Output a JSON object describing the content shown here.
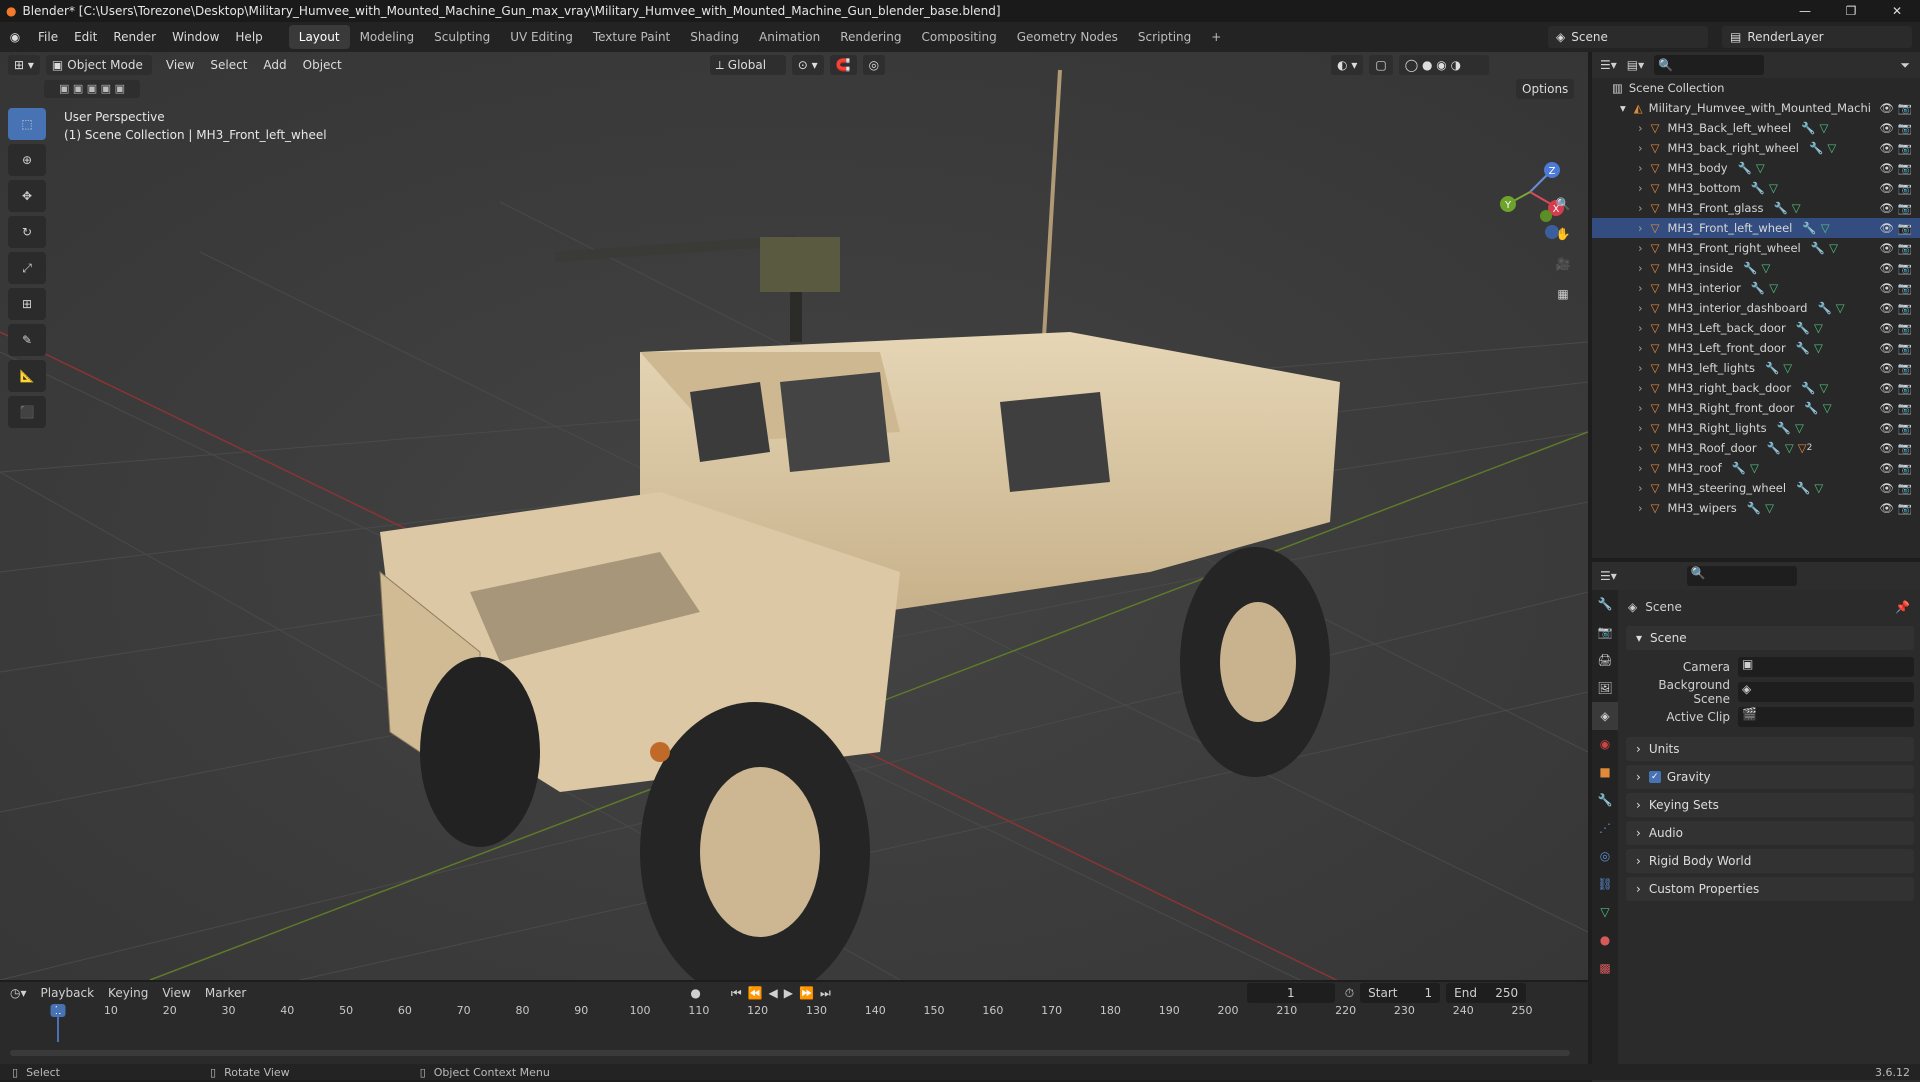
{
  "window": {
    "title": "Blender* [C:\\Users\\Torezone\\Desktop\\Military_Humvee_with_Mounted_Machine_Gun_max_vray\\Military_Humvee_with_Mounted_Machine_Gun_blender_base.blend]"
  },
  "menu": [
    "File",
    "Edit",
    "Render",
    "Window",
    "Help"
  ],
  "workspaces": [
    "Layout",
    "Modeling",
    "Sculpting",
    "UV Editing",
    "Texture Paint",
    "Shading",
    "Animation",
    "Rendering",
    "Compositing",
    "Geometry Nodes",
    "Scripting"
  ],
  "active_workspace": "Layout",
  "scene_name": "Scene",
  "render_layer": "RenderLayer",
  "viewport": {
    "mode": "Object Mode",
    "menus": [
      "View",
      "Select",
      "Add",
      "Object"
    ],
    "orientation": "Global",
    "options_label": "Options",
    "perspective_label": "User Perspective",
    "collection_label": "(1) Scene Collection | MH3_Front_left_wheel",
    "gizmo_axes": [
      "X",
      "Y",
      "Z"
    ]
  },
  "outliner": {
    "root": "Scene Collection",
    "collection": "Military_Humvee_with_Mounted_Machi",
    "objects": [
      "MH3_Back_left_wheel",
      "MH3_back_right_wheel",
      "MH3_body",
      "MH3_bottom",
      "MH3_Front_glass",
      "MH3_Front_left_wheel",
      "MH3_Front_right_wheel",
      "MH3_inside",
      "MH3_interior",
      "MH3_interior_dashboard",
      "MH3_Left_back_door",
      "MH3_Left_front_door",
      "MH3_left_lights",
      "MH3_right_back_door",
      "MH3_Right_front_door",
      "MH3_Right_lights",
      "MH3_Roof_door",
      "MH3_roof",
      "MH3_steering_wheel",
      "MH3_wipers"
    ],
    "selected": "MH3_Front_left_wheel",
    "roof_door_badge": "2"
  },
  "properties": {
    "context": "Scene",
    "panel_title": "Scene",
    "fields": [
      {
        "label": "Camera"
      },
      {
        "label": "Background Scene"
      },
      {
        "label": "Active Clip"
      }
    ],
    "subpanels": [
      "Units",
      "Gravity",
      "Keying Sets",
      "Audio",
      "Rigid Body World",
      "Custom Properties"
    ],
    "gravity_checked": true
  },
  "timeline": {
    "menus": [
      "Playback",
      "Keying",
      "View",
      "Marker"
    ],
    "current_frame": "1",
    "start_label": "Start",
    "start": "1",
    "end_label": "End",
    "end": "250",
    "ticks": [
      "1",
      "10",
      "20",
      "30",
      "40",
      "50",
      "60",
      "70",
      "80",
      "90",
      "100",
      "110",
      "120",
      "130",
      "140",
      "150",
      "160",
      "170",
      "180",
      "190",
      "200",
      "210",
      "220",
      "230",
      "240",
      "250"
    ]
  },
  "statusbar": {
    "select": "Select",
    "rotate": "Rotate View",
    "context_menu": "Object Context Menu",
    "version": "3.6.12"
  },
  "colors": {
    "accent": "#4772b3",
    "selection": "#334d80",
    "object_icon": "#e08a3c",
    "vehicle": "#d8c4a0"
  }
}
